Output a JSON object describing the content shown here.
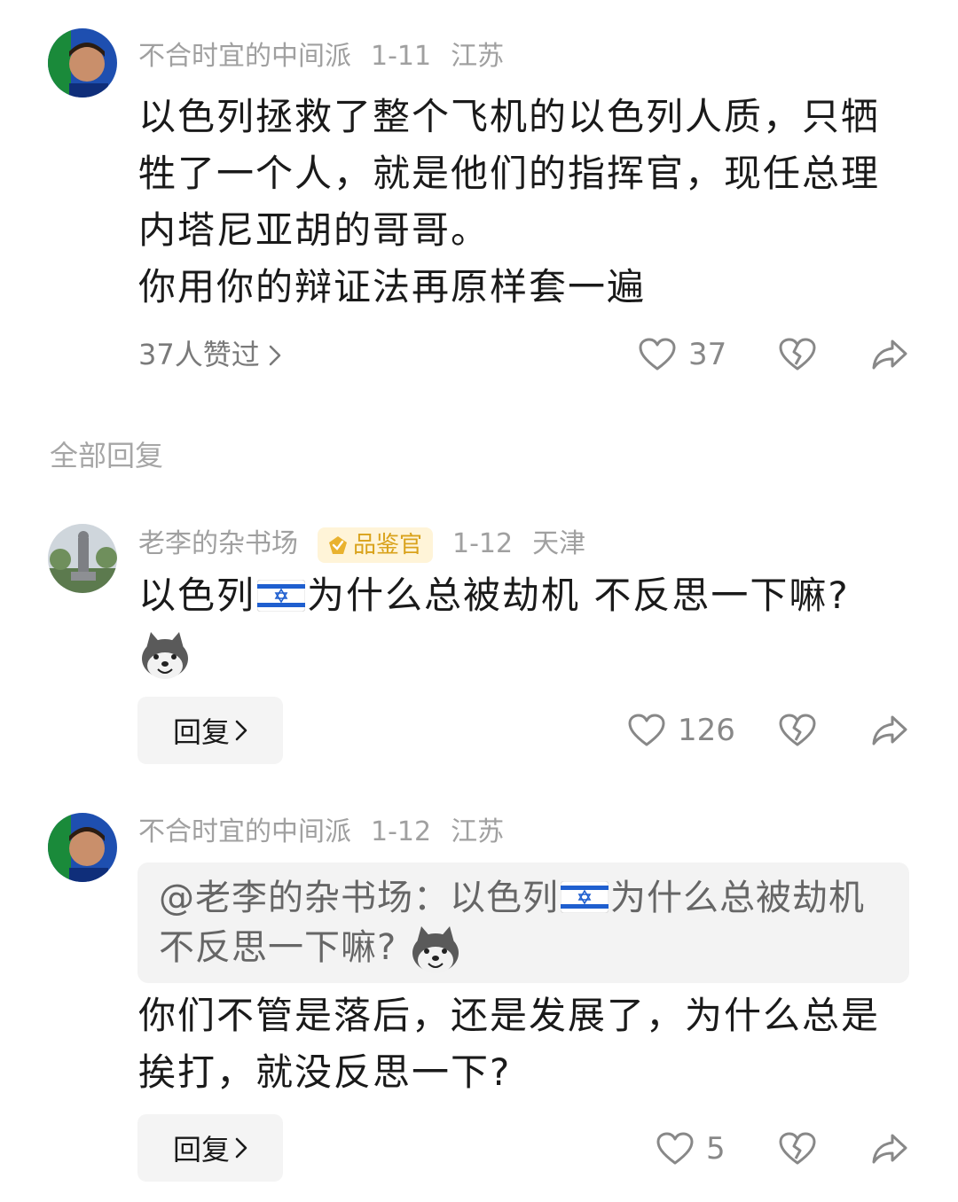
{
  "main_comment": {
    "username": "不合时宜的中间派",
    "date": "1-11",
    "location": "江苏",
    "lines": [
      "以色列拯救了整个飞机的以色列人质，只牺",
      "牲了一个人，就是他们的指挥官，现任总理",
      "内塔尼亚胡的哥哥。",
      "你用你的辩证法再原样套一遍"
    ],
    "likers_text": "37人赞过",
    "like_count": "37"
  },
  "section_title": "全部回复",
  "replies": [
    {
      "username": "老李的杂书场",
      "badge": "品鉴官",
      "date": "1-12",
      "location": "天津",
      "text_before_flag": "以色列",
      "text_after_flag": "为什么总被劫机 不反思一下嘛?",
      "reply_label": "回复",
      "like_count": "126"
    },
    {
      "username": "不合时宜的中间派",
      "date": "1-12",
      "location": "江苏",
      "quote_before_flag": "@老李的杂书场：以色列",
      "quote_after_flag": "为什么总被劫机",
      "quote_line2": "不反思一下嘛?",
      "lines": [
        "你们不管是落后，还是发展了，为什么总是",
        "挨打，就没反思一下?"
      ],
      "reply_label": "回复",
      "like_count": "5"
    }
  ],
  "icons": {
    "like": "heart-outline-icon",
    "dislike": "broken-heart-icon",
    "share": "share-arrow-icon",
    "chevron": "chevron-right-icon",
    "flag": "israel-flag-emoji",
    "wolf": "wolf-emoji"
  },
  "colors": {
    "muted": "#a0a0a0",
    "text": "#1a1a1a",
    "badge_bg": "#fff4d8",
    "badge_fg": "#d9a21b",
    "button_bg": "#f4f4f4"
  }
}
